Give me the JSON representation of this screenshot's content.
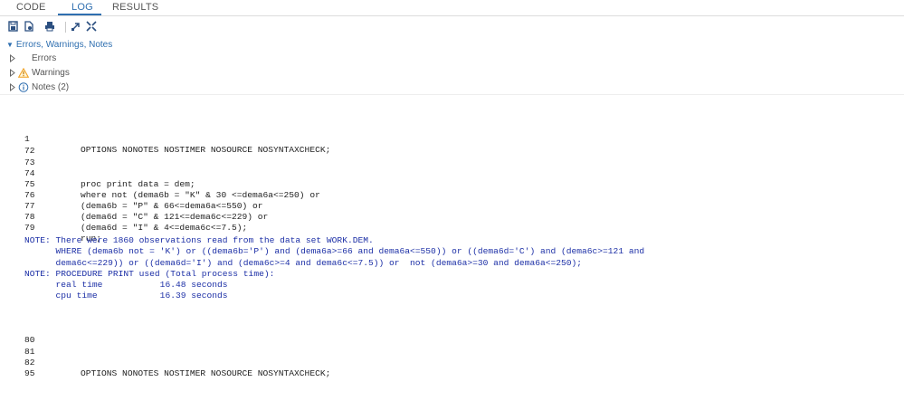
{
  "tabs": [
    {
      "label": "CODE",
      "active": false
    },
    {
      "label": "LOG",
      "active": true
    },
    {
      "label": "RESULTS",
      "active": false
    }
  ],
  "toolbar": {
    "icons": [
      "save-log-icon",
      "export-log-icon",
      "print-icon",
      "expand-icon",
      "collapse-icon"
    ]
  },
  "tree": {
    "header": "Errors, Warnings, Notes",
    "items": [
      {
        "label": "Errors",
        "icon": "none"
      },
      {
        "label": "Warnings",
        "icon": "warning-icon"
      },
      {
        "label": "Notes (2)",
        "icon": "info-icon"
      }
    ]
  },
  "log": {
    "block1": [
      {
        "num": "1",
        "text": "OPTIONS NONOTES NOSTIMER NOSOURCE NOSYNTAXCHECK;"
      },
      {
        "num": "72",
        "text": ""
      },
      {
        "num": "73",
        "text": ""
      },
      {
        "num": "74",
        "text": "proc print data = dem;"
      },
      {
        "num": "75",
        "text": "where not (dema6b = \"K\" & 30 <=dema6a<=250) or"
      },
      {
        "num": "76",
        "text": "(dema6b = \"P\" & 66<=dema6a<=550) or"
      },
      {
        "num": "77",
        "text": "(dema6d = \"C\" & 121<=dema6c<=229) or"
      },
      {
        "num": "78",
        "text": "(dema6d = \"I\" & 4<=dema6c<=7.5);"
      },
      {
        "num": "79",
        "text": "run;"
      }
    ],
    "notes": [
      "NOTE: There were 1860 observations read from the data set WORK.DEM.",
      "      WHERE (dema6b not = 'K') or ((dema6b='P') and (dema6a>=66 and dema6a<=550)) or ((dema6d='C') and (dema6c>=121 and",
      "      dema6c<=229)) or ((dema6d='I') and (dema6c>=4 and dema6c<=7.5)) or  not (dema6a>=30 and dema6a<=250);",
      "NOTE: PROCEDURE PRINT used (Total process time):",
      "      real time           16.48 seconds",
      "      cpu time            16.39 seconds"
    ],
    "block2": [
      {
        "num": "80",
        "text": ""
      },
      {
        "num": "81",
        "text": ""
      },
      {
        "num": "82",
        "text": "OPTIONS NONOTES NOSTIMER NOSOURCE NOSYNTAXCHECK;"
      },
      {
        "num": "95",
        "text": ""
      }
    ]
  },
  "colors": {
    "accent": "#2f6fb0",
    "note_text": "#1c2fa6",
    "warning": "#f0a020",
    "info": "#2f6fb0"
  }
}
